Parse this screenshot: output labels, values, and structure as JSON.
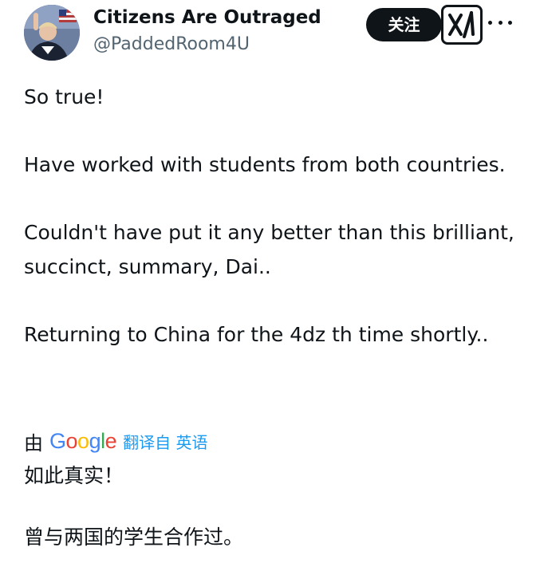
{
  "author": {
    "display_name": "Citizens Are Outraged",
    "handle": "@PaddedRoom4U",
    "avatar_icon": "profile-photo"
  },
  "actions": {
    "follow_label": "关注",
    "grok_icon": "grok-icon",
    "more_icon": "more-icon"
  },
  "tweet": {
    "paragraphs": [
      "So true!",
      "Have worked with students from both countries.",
      "Couldn't have put it any better than this brilliant, succinct, summary, Dai..",
      "Returning to China for the 4dz th time shortly.."
    ]
  },
  "translation": {
    "by_label": "由",
    "provider": "Google",
    "link_label": "翻译自 英语",
    "lines": [
      "如此真实！",
      "曾与两国的学生合作过。"
    ]
  },
  "colors": {
    "text": "#0f1419",
    "secondary": "#536471",
    "link": "#1d9bf0",
    "button_bg": "#0f1419"
  }
}
